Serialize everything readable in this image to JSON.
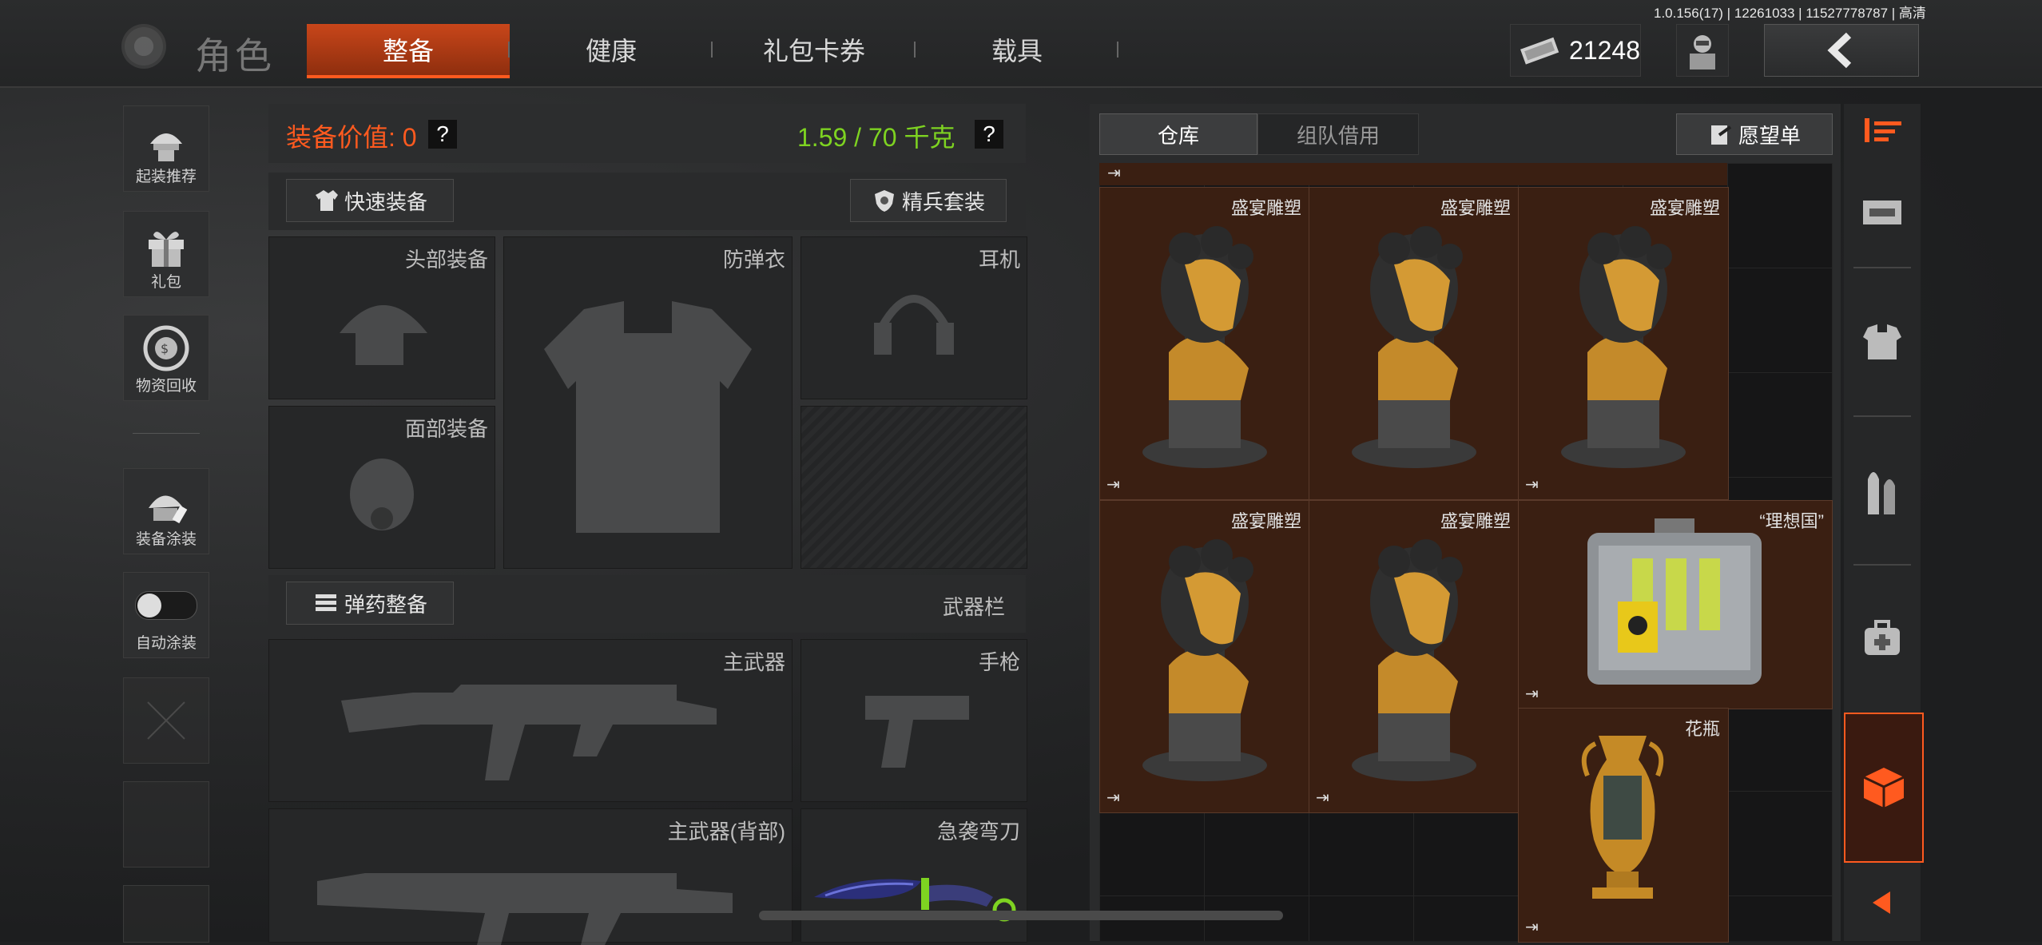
{
  "version_text": "1.0.156(17) | 12261033 | 11527778787 | 高清",
  "header": {
    "title": "角色",
    "tabs": [
      {
        "label": "整备",
        "active": true
      },
      {
        "label": "健康",
        "active": false
      },
      {
        "label": "礼包卡券",
        "active": false
      },
      {
        "label": "载具",
        "active": false
      }
    ],
    "currency": "21248"
  },
  "sidebar": {
    "items": [
      {
        "label": "起装推荐",
        "icon": "soldier-helmet-icon"
      },
      {
        "label": "礼包",
        "icon": "gift-icon"
      },
      {
        "label": "物资回收",
        "icon": "recycle-icon"
      },
      {
        "label": "装备涂装",
        "icon": "paint-helmet-icon"
      },
      {
        "label": "自动涂装",
        "icon": "toggle-switch",
        "toggle_on": false
      }
    ]
  },
  "equipment": {
    "value_label": "装备价值: 0",
    "weight_label": "1.59 / 70 千克",
    "quick_equip": "快速装备",
    "elite_set": "精兵套装",
    "slots": {
      "head": "头部装备",
      "armor": "防弹衣",
      "headset": "耳机",
      "face": "面部装备"
    },
    "ammo_button": "弹药整备",
    "weapon_bar": "武器栏",
    "weapons": {
      "primary": "主武器",
      "pistol": "手枪",
      "primary_back": "主武器(背部)",
      "melee": "急袭弯刀"
    }
  },
  "storage": {
    "tabs": [
      {
        "label": "仓库",
        "active": true
      },
      {
        "label": "组队借用",
        "active": false
      }
    ],
    "wishlist": "愿望单",
    "items": [
      {
        "name": "盛宴雕塑",
        "kind": "bust"
      },
      {
        "name": "盛宴雕塑",
        "kind": "bust"
      },
      {
        "name": "盛宴雕塑",
        "kind": "bust"
      },
      {
        "name": "盛宴雕塑",
        "kind": "bust"
      },
      {
        "name": "盛宴雕塑",
        "kind": "bust"
      },
      {
        "name": "“理想国”",
        "kind": "case"
      },
      {
        "name": "花瓶",
        "kind": "vase"
      }
    ]
  },
  "right_tabs": [
    "all-items-icon",
    "ticket-icon",
    "armor-icon",
    "ammo-icon",
    "medkit-icon",
    "special-box-icon",
    "collapse-arrow-icon"
  ],
  "colors": {
    "accent": "#ff5a1f",
    "weight_green": "#7ed321",
    "value_orange": "#ff5a1f",
    "item_bg": "#3a1f12"
  }
}
